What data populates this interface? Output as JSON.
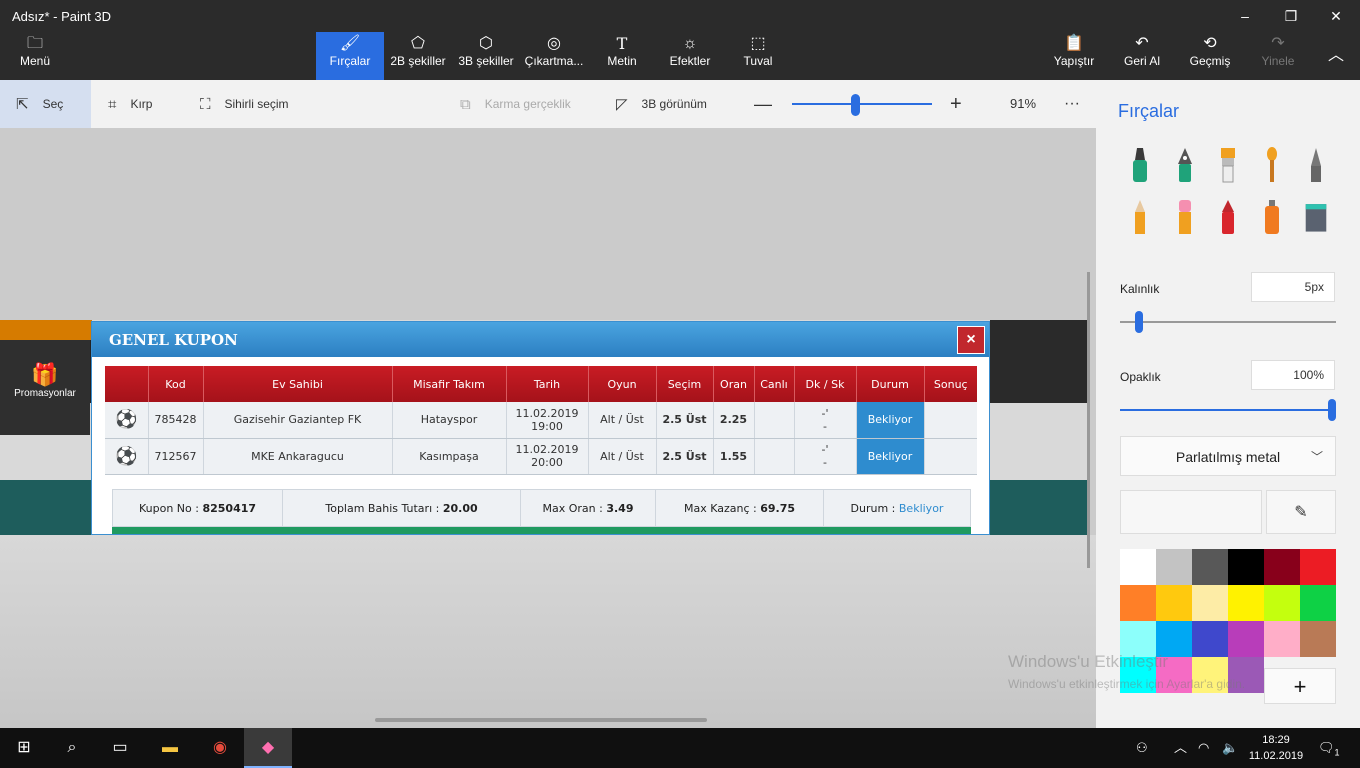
{
  "window": {
    "title": "Adsız* - Paint 3D"
  },
  "ribbon": {
    "menu": "Menü",
    "tabs": [
      "Fırçalar",
      "2B şekiller",
      "3B şekiller",
      "Çıkartma...",
      "Metin",
      "Efektler",
      "Tuval"
    ],
    "actions": [
      "Yapıştır",
      "Geri Al",
      "Geçmiş",
      "Yinele"
    ]
  },
  "toolbar": {
    "select": "Seç",
    "crop": "Kırp",
    "magic_select": "Sihirli seçim",
    "mixed_reality": "Karma gerçeklik",
    "view3d": "3B görünüm",
    "zoom_percent": "91%",
    "zoom_level": 0.45
  },
  "canvas": {
    "promo_label": "Promasyonlar",
    "modal": {
      "title": "GENEL KUPON",
      "close": "×",
      "headers": [
        "",
        "Kod",
        "Ev Sahibi",
        "Misafir Takım",
        "Tarih",
        "Oyun",
        "Seçim",
        "Oran",
        "Canlı",
        "Dk / Sk",
        "Durum",
        "Sonuç"
      ],
      "rows": [
        {
          "code": "785428",
          "home": "Gazisehir Gaziantep FK",
          "away": "Hatayspor",
          "date": "11.02.2019",
          "time": "19:00",
          "game": "Alt / Üst",
          "pick": "2.5 Üst",
          "odds": "2.25",
          "live": "",
          "dk1": "-'",
          "dk2": "-",
          "status": "Bekliyor",
          "result": ""
        },
        {
          "code": "712567",
          "home": "MKE Ankaragucu",
          "away": "Kasımpaşa",
          "date": "11.02.2019",
          "time": "20:00",
          "game": "Alt / Üst",
          "pick": "2.5 Üst",
          "odds": "1.55",
          "live": "",
          "dk1": "-'",
          "dk2": "-",
          "status": "Bekliyor",
          "result": ""
        }
      ],
      "summary": {
        "coupon_label": "Kupon No :",
        "coupon_no": "8250417",
        "total_label": "Toplam Bahis Tutarı :",
        "total": "20.00",
        "maxodds_label": "Max Oran :",
        "maxodds": "3.49",
        "maxwin_label": "Max Kazanç :",
        "maxwin": "69.75",
        "status_label": "Durum :",
        "status": "Bekliyor"
      }
    }
  },
  "panel": {
    "title": "Fırçalar",
    "thickness_label": "Kalınlık",
    "thickness_value": "5px",
    "thickness_level": 0.05,
    "opacity_label": "Opaklık",
    "opacity_value": "100%",
    "opacity_level": 1.0,
    "material": "Parlatılmış metal",
    "colors": [
      "#ffffff",
      "#c3c3c3",
      "#585858",
      "#000000",
      "#88001b",
      "#ec1c24",
      "#ff7f27",
      "#ffc90e",
      "#fdeca6",
      "#fff200",
      "#c4ff0e",
      "#0ed145",
      "#8cfffb",
      "#00a8f3",
      "#3f48cc",
      "#b83dba",
      "#ffaec8",
      "#b97a56",
      "#00ffff",
      "#f56bc4",
      "#fff37a",
      "#9b59b6"
    ]
  },
  "watermark": {
    "line1": "Windows'u Etkinleştir",
    "line2": "Windows'u etkinleştirmek için Ayarlar'a gidin."
  },
  "taskbar": {
    "time": "18:29",
    "date": "11.02.2019",
    "notifications": "1"
  }
}
